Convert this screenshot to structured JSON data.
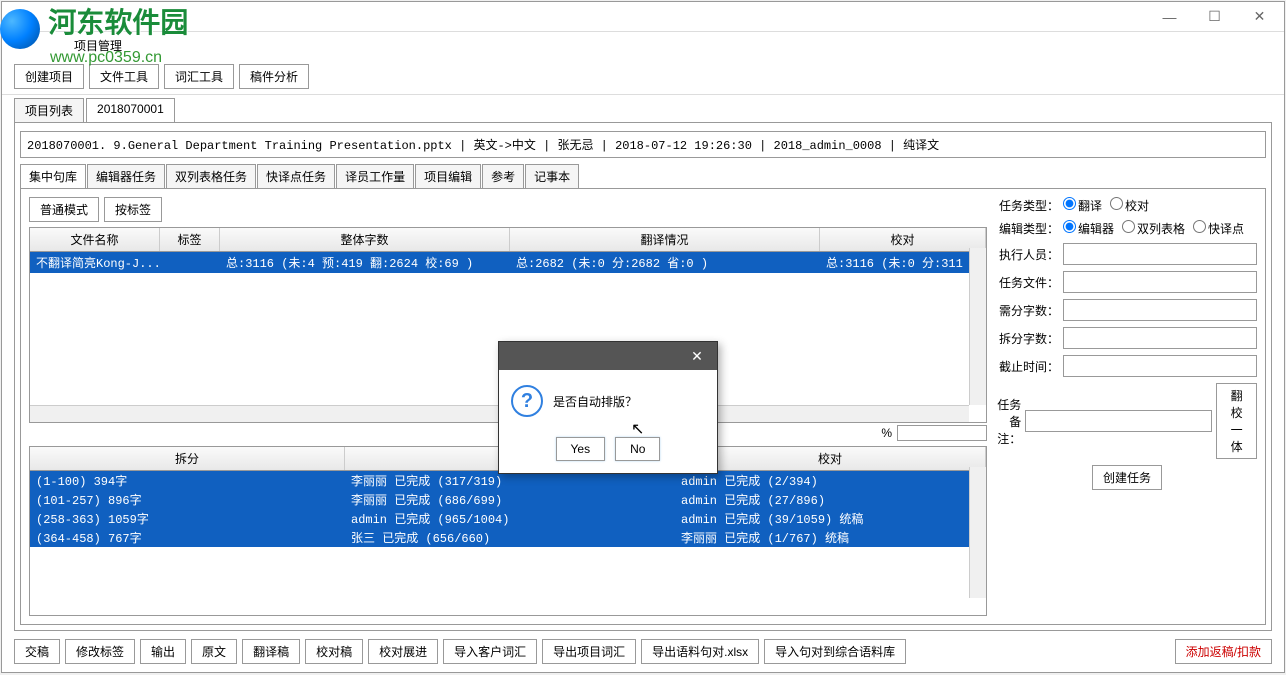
{
  "watermark": {
    "text": "河东软件园",
    "url": "www.pc0359.cn"
  },
  "menubar": {
    "item1": "项目管理"
  },
  "window_controls": {
    "min": "—",
    "max": "☐",
    "close": "✕"
  },
  "toolbar": {
    "create_project": "创建项目",
    "file_tools": "文件工具",
    "vocab_tools": "词汇工具",
    "file_analysis": "稿件分析"
  },
  "tabs": {
    "list": "项目列表",
    "project_id": "2018070001"
  },
  "breadcrumb": "2018070001. 9.General Department Training Presentation.pptx | 英文->中文 | 张无忌 | 2018-07-12 19:26:30 | 2018_admin_0008 | 纯译文",
  "subtabs": {
    "t1": "集中句库",
    "t2": "编辑器任务",
    "t3": "双列表格任务",
    "t4": "快译点任务",
    "t5": "译员工作量",
    "t6": "项目编辑",
    "t7": "参考",
    "t8": "记事本"
  },
  "mode": {
    "normal": "普通模式",
    "tag": "按标签"
  },
  "table1": {
    "headers": {
      "filename": "文件名称",
      "label": "标签",
      "total_words": "整体字数",
      "trans_status": "翻译情况",
      "proof": "校对"
    },
    "row": {
      "filename": "不翻译简亮Kong-J...",
      "total": "总:3116 (未:4    预:419  翻:2624 校:69  )",
      "trans": "总:2682 (未:0    分:2682 省:0      )",
      "proof": "总:3116 (未:0    分:311"
    }
  },
  "progress_pct": "%",
  "table2": {
    "headers": {
      "split": "拆分",
      "trans": "翻",
      "proof": "校对"
    },
    "rows": [
      {
        "split": "(1-100) 394字",
        "trans": "李丽丽 已完成 (317/319)",
        "proof": "admin 已完成 (2/394)"
      },
      {
        "split": "(101-257) 896字",
        "trans": "李丽丽 已完成 (686/699)",
        "proof": "admin 已完成 (27/896)"
      },
      {
        "split": "(258-363) 1059字",
        "trans": "admin 已完成 (965/1004)",
        "proof": "admin 已完成 (39/1059) 统稿"
      },
      {
        "split": "(364-458) 767字",
        "trans": "张三 已完成 (656/660)",
        "proof": "李丽丽 已完成 (1/767) 统稿"
      }
    ]
  },
  "right_form": {
    "task_type_label": "任务类型：",
    "task_type_trans": "翻译",
    "task_type_proof": "校对",
    "edit_type_label": "编辑类型：",
    "edit_editor": "编辑器",
    "edit_dual": "双列表格",
    "edit_quick": "快译点",
    "executor": "执行人员：",
    "task_file": "任务文件：",
    "need_words": "需分字数：",
    "split_words": "拆分字数：",
    "deadline": "截止时间：",
    "task_note": "任务备注：",
    "trans_proof_btn": "翻校一体",
    "create_task_btn": "创建任务"
  },
  "bottom_buttons": {
    "submit": "交稿",
    "modify_label": "修改标签",
    "output": "输出",
    "original": "原文",
    "translation": "翻译稿",
    "proofread": "校对稿",
    "proof_expand": "校对展进",
    "import_client_vocab": "导入客户词汇",
    "export_project_vocab": "导出项目词汇",
    "export_corpus": "导出语料句对.xlsx",
    "import_corpus": "导入句对到综合语料库",
    "add_rework": "添加返稿/扣款"
  },
  "dialog": {
    "message": "是否自动排版？",
    "yes": "Yes",
    "no": "No",
    "close": "✕"
  }
}
